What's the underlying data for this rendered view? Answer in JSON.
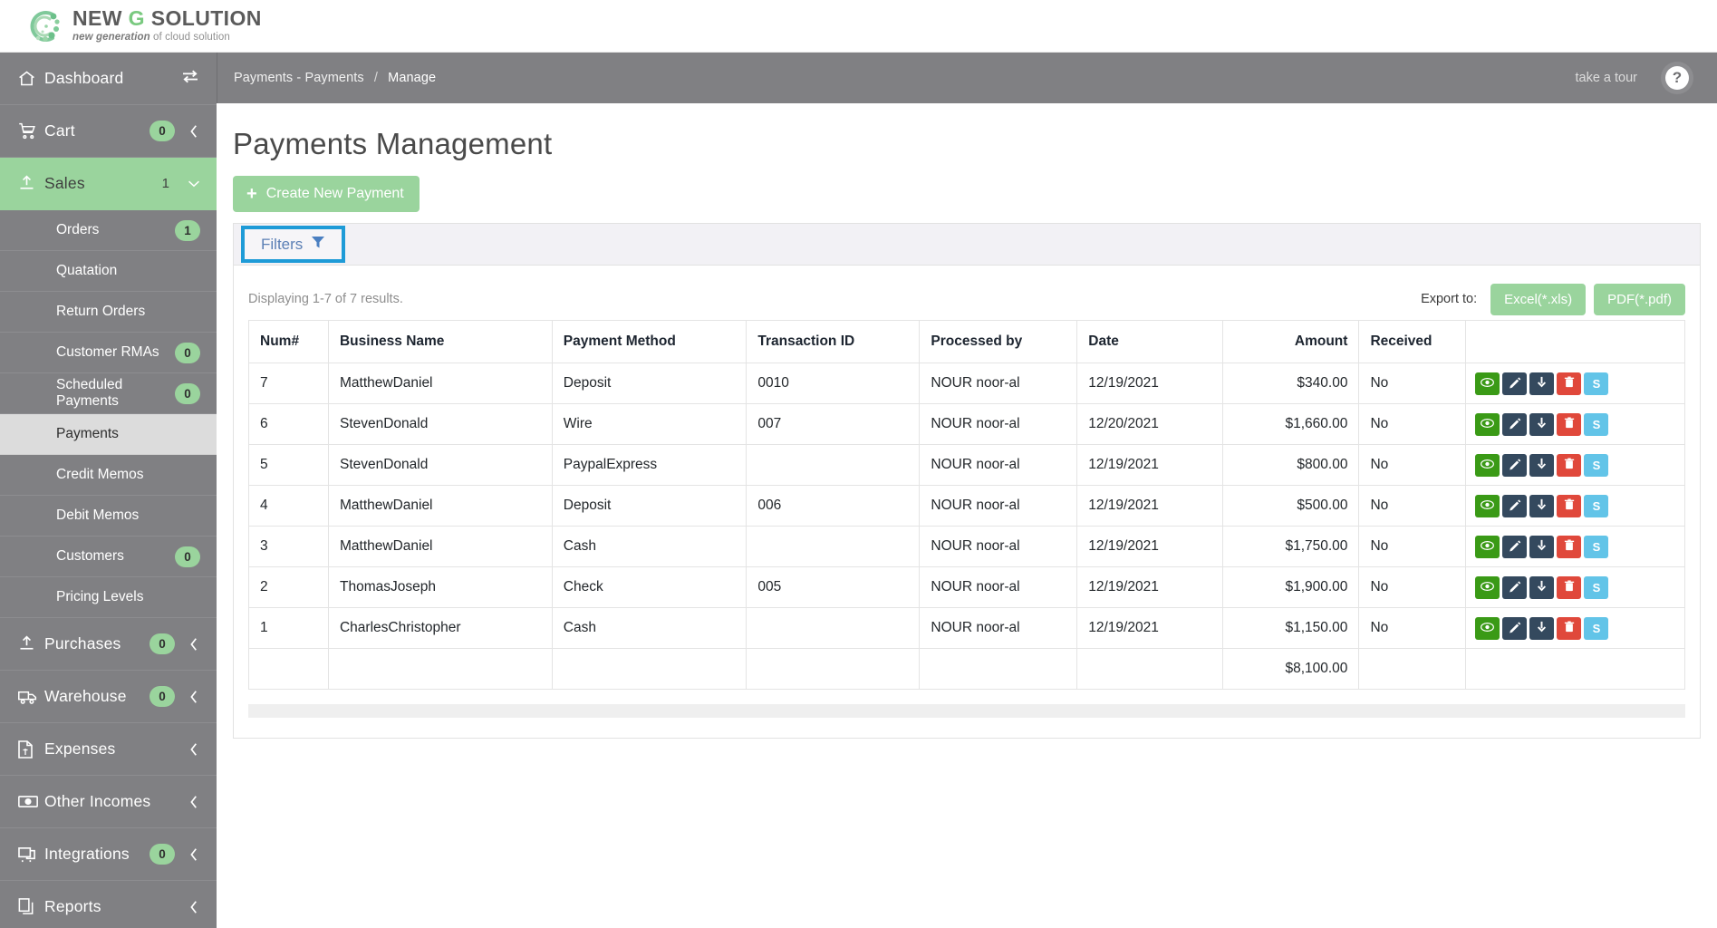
{
  "brand": {
    "title_part1": "NEW ",
    "title_g": "G",
    "title_part2": " SOLUTION",
    "tagline_italic": "new generation",
    "tagline_rest": " of cloud solution",
    "accent_green": "#9ad49d"
  },
  "sidebar": {
    "items": [
      {
        "label": "Dashboard",
        "icon": "home-icon",
        "badge": null,
        "chevron": null,
        "swap": true,
        "active": false
      },
      {
        "label": "Cart",
        "icon": "cart-icon",
        "badge": "0",
        "chevron": "left",
        "swap": false,
        "active": false
      },
      {
        "label": "Sales",
        "icon": "upload-icon",
        "count": "1",
        "chevron": "down",
        "swap": false,
        "active": true
      }
    ],
    "sales_subitems": [
      {
        "label": "Orders",
        "badge": "1",
        "current": false
      },
      {
        "label": "Quatation",
        "badge": null,
        "current": false
      },
      {
        "label": "Return Orders",
        "badge": null,
        "current": false
      },
      {
        "label": "Customer RMAs",
        "badge": "0",
        "current": false
      },
      {
        "label": "Scheduled Payments",
        "badge": "0",
        "current": false
      },
      {
        "label": "Payments",
        "badge": null,
        "current": true
      },
      {
        "label": "Credit Memos",
        "badge": null,
        "current": false
      },
      {
        "label": "Debit Memos",
        "badge": null,
        "current": false
      },
      {
        "label": "Customers",
        "badge": "0",
        "current": false
      },
      {
        "label": "Pricing Levels",
        "badge": null,
        "current": false
      }
    ],
    "bottom_items": [
      {
        "label": "Purchases",
        "icon": "upload-icon",
        "badge": "0",
        "chevron": "left"
      },
      {
        "label": "Warehouse",
        "icon": "truck-icon",
        "badge": "0",
        "chevron": "left"
      },
      {
        "label": "Expenses",
        "icon": "invoice-icon",
        "badge": null,
        "chevron": "left"
      },
      {
        "label": "Other Incomes",
        "icon": "money-icon",
        "badge": null,
        "chevron": "left"
      },
      {
        "label": "Integrations",
        "icon": "plug-icon",
        "badge": "0",
        "chevron": "left"
      },
      {
        "label": "Reports",
        "icon": "copy-icon",
        "badge": null,
        "chevron": "left"
      }
    ]
  },
  "topbar": {
    "breadcrumb_root": "Payments - Payments",
    "breadcrumb_sep": "/",
    "breadcrumb_current": "Manage",
    "take_a_tour": "take a tour",
    "help_glyph": "?"
  },
  "page": {
    "title": "Payments Management",
    "create_button": "Create New Payment",
    "create_plus": "+",
    "filters_button": "Filters",
    "displaying": "Displaying 1-7 of 7 results.",
    "export_label": "Export to:",
    "export_excel": "Excel(*.xls)",
    "export_pdf": "PDF(*.pdf)"
  },
  "table": {
    "headers": [
      "Num#",
      "Business Name",
      "Payment Method",
      "Transaction ID",
      "Processed by",
      "Date",
      "Amount",
      "Received",
      ""
    ],
    "rows": [
      {
        "num": "7",
        "business": "MatthewDaniel",
        "method": "Deposit",
        "txn": "0010",
        "processed": "NOUR noor-al",
        "date": "12/19/2021",
        "amount": "$340.00",
        "received": "No"
      },
      {
        "num": "6",
        "business": "StevenDonald",
        "method": "Wire",
        "txn": "007",
        "processed": "NOUR noor-al",
        "date": "12/20/2021",
        "amount": "$1,660.00",
        "received": "No"
      },
      {
        "num": "5",
        "business": "StevenDonald",
        "method": "PaypalExpress",
        "txn": "",
        "processed": "NOUR noor-al",
        "date": "12/19/2021",
        "amount": "$800.00",
        "received": "No"
      },
      {
        "num": "4",
        "business": "MatthewDaniel",
        "method": "Deposit",
        "txn": "006",
        "processed": "NOUR noor-al",
        "date": "12/19/2021",
        "amount": "$500.00",
        "received": "No"
      },
      {
        "num": "3",
        "business": "MatthewDaniel",
        "method": "Cash",
        "txn": "",
        "processed": "NOUR noor-al",
        "date": "12/19/2021",
        "amount": "$1,750.00",
        "received": "No"
      },
      {
        "num": "2",
        "business": "ThomasJoseph",
        "method": "Check",
        "txn": "005",
        "processed": "NOUR noor-al",
        "date": "12/19/2021",
        "amount": "$1,900.00",
        "received": "No"
      },
      {
        "num": "1",
        "business": "CharlesChristopher",
        "method": "Cash",
        "txn": "",
        "processed": "NOUR noor-al",
        "date": "12/19/2021",
        "amount": "$1,150.00",
        "received": "No"
      }
    ],
    "total_row": {
      "amount": "$8,100.00"
    },
    "row_actions": [
      {
        "name": "view",
        "glyph": "eye",
        "color": "#3a9a16"
      },
      {
        "name": "edit",
        "glyph": "pen",
        "color": "#34495e"
      },
      {
        "name": "download",
        "glyph": "down",
        "color": "#34495e"
      },
      {
        "name": "delete",
        "glyph": "trash",
        "color": "#e0483b"
      },
      {
        "name": "schedule",
        "glyph": "S",
        "color": "#62c4e8"
      }
    ]
  }
}
